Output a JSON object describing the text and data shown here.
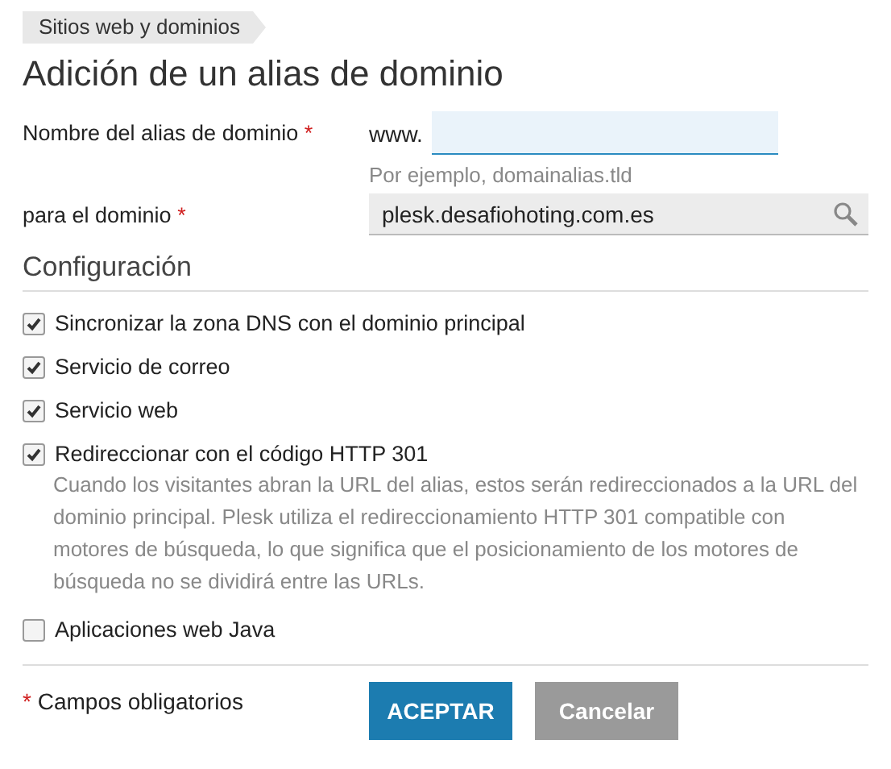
{
  "breadcrumb": "Sitios web y dominios",
  "title": "Adición de un alias de dominio",
  "alias_field": {
    "label": "Nombre del alias de dominio",
    "required_mark": "*",
    "prefix": "www.",
    "hint": "Por ejemplo, domainalias.tld"
  },
  "domain_field": {
    "label": "para el dominio",
    "required_mark": "*",
    "value": "plesk.desafiohoting.com.es"
  },
  "section_title": "Configuración",
  "options": [
    {
      "label": "Sincronizar la zona DNS con el dominio principal",
      "checked": true
    },
    {
      "label": "Servicio de correo",
      "checked": true
    },
    {
      "label": "Servicio web",
      "checked": true
    },
    {
      "label": "Redireccionar con el código HTTP 301",
      "checked": true,
      "description": "Cuando los visitantes abran la URL del alias, estos serán redireccionados a la URL del dominio principal. Plesk utiliza el redireccionamiento HTTP 301 compatible con motores de búsqueda, lo que significa que el posicionamiento de los motores de búsqueda no se dividirá entre las URLs."
    },
    {
      "label": "Aplicaciones web Java",
      "checked": false
    }
  ],
  "footer": {
    "required_mark": "*",
    "required_note": "Campos obligatorios",
    "buttons": [
      {
        "label": "ACEPTAR",
        "kind": "primary"
      },
      {
        "label": "Cancelar",
        "kind": "secondary"
      }
    ]
  }
}
